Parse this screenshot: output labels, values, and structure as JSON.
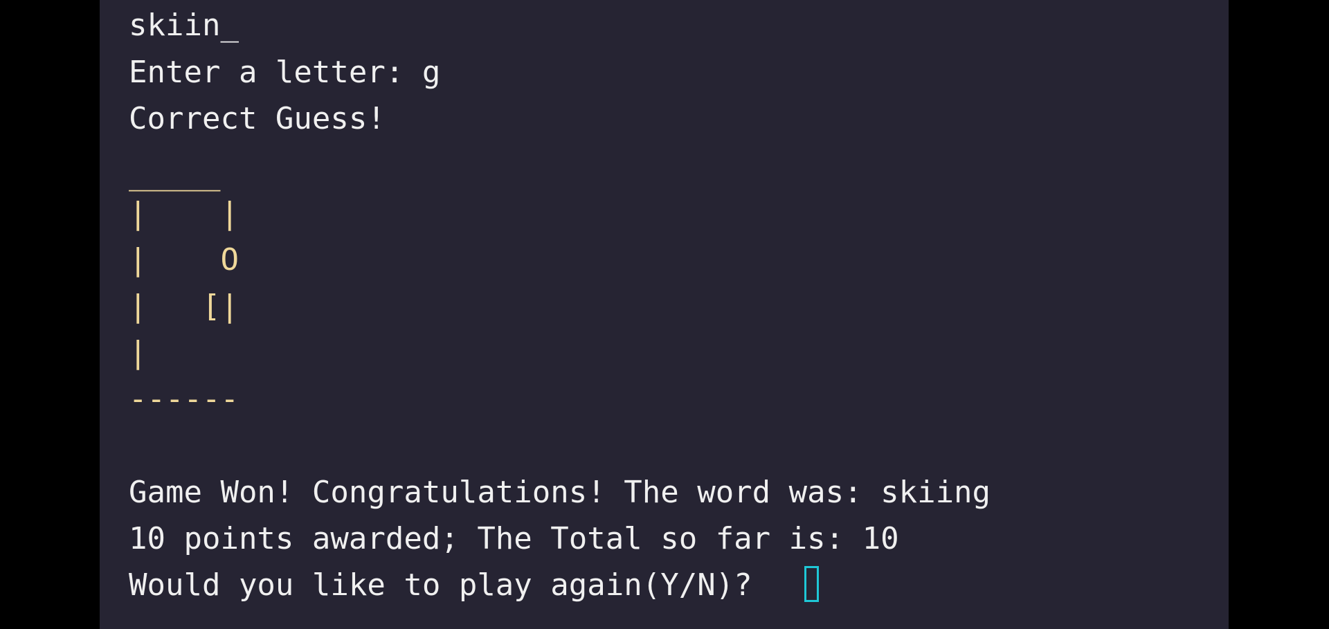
{
  "terminal": {
    "lines": [
      "skiin_",
      "Enter a letter: g",
      "Correct Guess!"
    ],
    "hangman": [
      "_____",
      "|    |",
      "|    O",
      "|   [|",
      "|",
      "------"
    ],
    "result_lines": [
      "Game Won! Congratulations! The word was: skiing",
      "10 points awarded; The Total so far is: 10",
      "Would you like to play again(Y/N)? "
    ]
  },
  "colors": {
    "page_background": "#000000",
    "terminal_background": "#262433",
    "text": "#f0f0f0",
    "hangman": "#efd89a",
    "cursor": "#1fc7d6"
  }
}
